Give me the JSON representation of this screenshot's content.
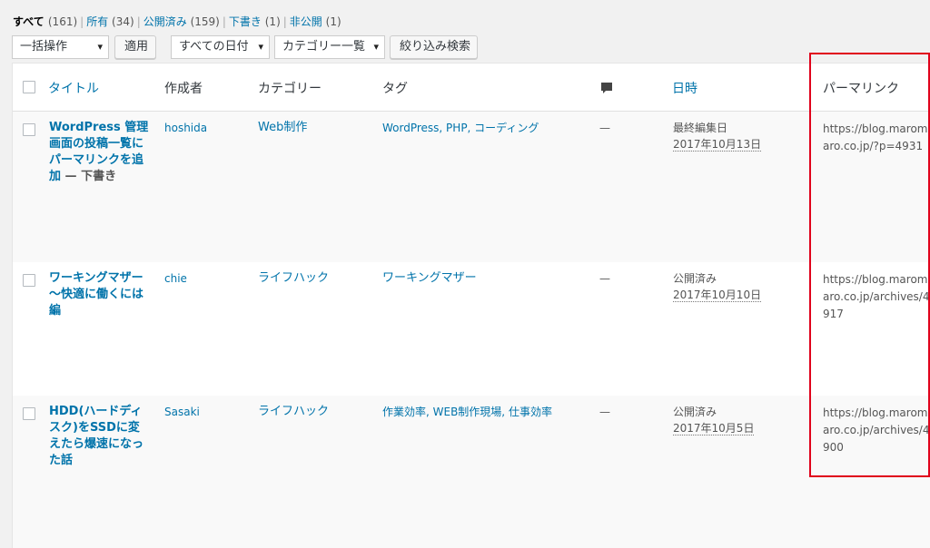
{
  "views": [
    {
      "label": "すべて",
      "count": "(161)",
      "current": true
    },
    {
      "label": "所有",
      "count": "(34)",
      "current": false
    },
    {
      "label": "公開済み",
      "count": "(159)",
      "current": false
    },
    {
      "label": "下書き",
      "count": "(1)",
      "current": false
    },
    {
      "label": "非公開",
      "count": "(1)",
      "current": false
    }
  ],
  "toolbar": {
    "bulk_action": "一括操作",
    "apply": "適用",
    "date_filter": "すべての日付",
    "category_filter": "カテゴリー一覧",
    "filter_button": "絞り込み検索"
  },
  "columns": {
    "title": "タイトル",
    "author": "作成者",
    "categories": "カテゴリー",
    "tags": "タグ",
    "date": "日時",
    "permalink": "パーマリンク"
  },
  "posts": [
    {
      "title": "WordPress 管理画面の投稿一覧にパーマリンクを追加",
      "state": " — 下書き",
      "author": "hoshida",
      "category": "Web制作",
      "tags": "WordPress, PHP, コーディング",
      "comments": "—",
      "date_status": "最終編集日",
      "date": "2017年10月13日",
      "permalink": "https://blog.maromaro.co.jp/?p=4931"
    },
    {
      "title": "ワーキングマザー　～快適に働くには編",
      "state": "",
      "author": "chie",
      "category": "ライフハック",
      "tags": "ワーキングマザー",
      "comments": "—",
      "date_status": "公開済み",
      "date": "2017年10月10日",
      "permalink": "https://blog.maromaro.co.jp/archives/4917"
    },
    {
      "title": "HDD(ハードディスク)をSSDに変えたら爆速になった話",
      "state": "",
      "author": "Sasaki",
      "category": "ライフハック",
      "tags": "作業効率, WEB制作現場, 仕事効率",
      "comments": "—",
      "date_status": "公開済み",
      "date": "2017年10月5日",
      "permalink": "https://blog.maromaro.co.jp/archives/4900"
    }
  ]
}
